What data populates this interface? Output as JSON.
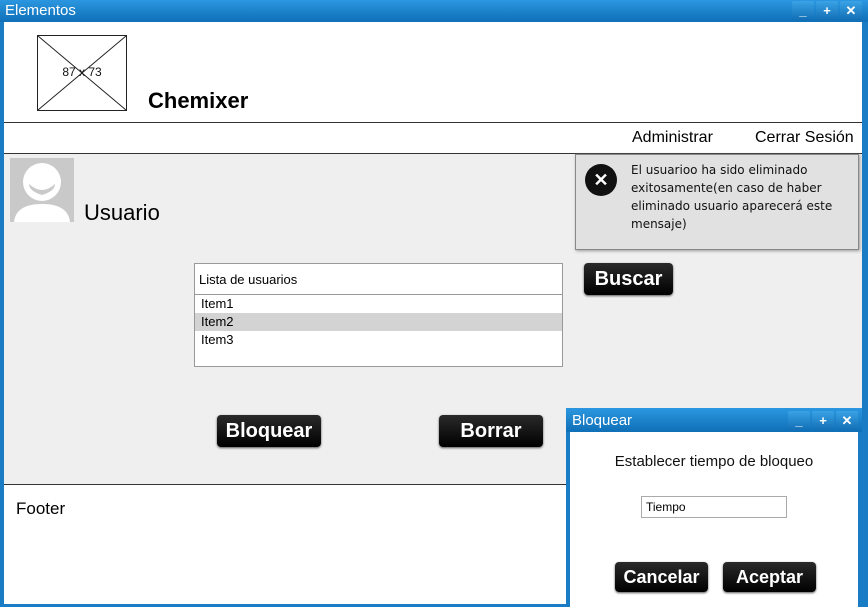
{
  "window": {
    "title": "Elementos",
    "controls": {
      "minimize": "_",
      "maximize": "+",
      "close": "✕"
    }
  },
  "header": {
    "logo_placeholder": "87 x 73",
    "app_name": "Chemixer"
  },
  "nav": {
    "admin": "Administrar",
    "logout": "Cerrar Sesión"
  },
  "user": {
    "label": "Usuario"
  },
  "alert": {
    "icon": "close-circle-icon",
    "message": "El usuarioo ha sido eliminado exitosamente(en caso de haber eliminado usuario aparecerá este mensaje)"
  },
  "user_list": {
    "header": "Lista de usuarios",
    "items": [
      {
        "label": "Item1",
        "selected": false
      },
      {
        "label": "Item2",
        "selected": true
      },
      {
        "label": "Item3",
        "selected": false
      }
    ]
  },
  "actions": {
    "search": "Buscar",
    "block": "Bloquear",
    "delete": "Borrar"
  },
  "footer": {
    "text": "Footer"
  },
  "dialog": {
    "title": "Bloquear",
    "controls": {
      "minimize": "_",
      "maximize": "+",
      "close": "✕"
    },
    "message": "Establecer tiempo de bloqueo",
    "time_value": "Tiempo",
    "cancel": "Cancelar",
    "accept": "Aceptar"
  }
}
